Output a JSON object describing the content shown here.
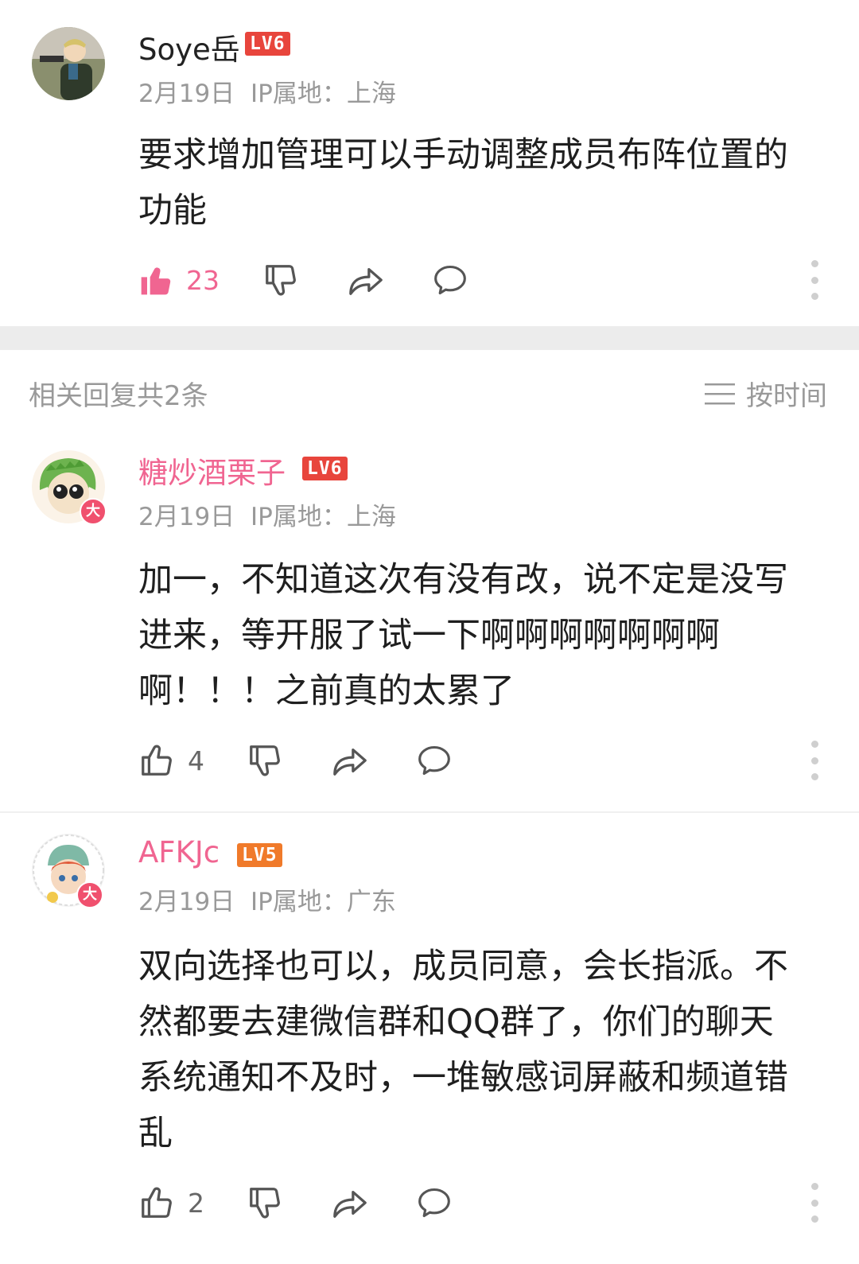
{
  "main_post": {
    "username": "Soye岳",
    "level": "LV6",
    "date": "2月19日",
    "ip_label": "IP属地：",
    "ip_location": "上海",
    "content_line1": "要求增加管理可以手动调整成员布阵位置的",
    "content_line2": "功能",
    "like_count": "23",
    "liked": true
  },
  "replies_section": {
    "count_label": "相关回复共2条",
    "sort_label": "按时间"
  },
  "replies": [
    {
      "username": "糖炒酒栗子",
      "level": "LV6",
      "badge": "大",
      "date": "2月19日",
      "ip_label": "IP属地：",
      "ip_location": "上海",
      "content_lines": [
        "加一，不知道这次有没有改，说不定是没写",
        "进来，等开服了试一下啊啊啊啊啊啊啊",
        "啊！！！之前真的太累了"
      ],
      "like_count": "4"
    },
    {
      "username": "AFKJc",
      "level": "LV5",
      "badge": "大",
      "date": "2月19日",
      "ip_label": "IP属地：",
      "ip_location": "广东",
      "content_lines": [
        "双向选择也可以，成员同意，会长指派。不",
        "然都要去建微信群和QQ群了，你们的聊天",
        "系统通知不及时，一堆敏感词屏蔽和频道错",
        "乱"
      ],
      "like_count": "2"
    }
  ],
  "colors": {
    "accent_pink": "#f06591",
    "level_red": "#e8453c",
    "level_orange": "#f07a2a",
    "meta_gray": "#999999"
  },
  "icons": {
    "like": "thumbs-up-icon",
    "dislike": "thumbs-down-icon",
    "share": "share-arrow-icon",
    "comment": "comment-bubble-icon",
    "more": "more-vertical-icon",
    "sort": "sort-lines-icon"
  }
}
